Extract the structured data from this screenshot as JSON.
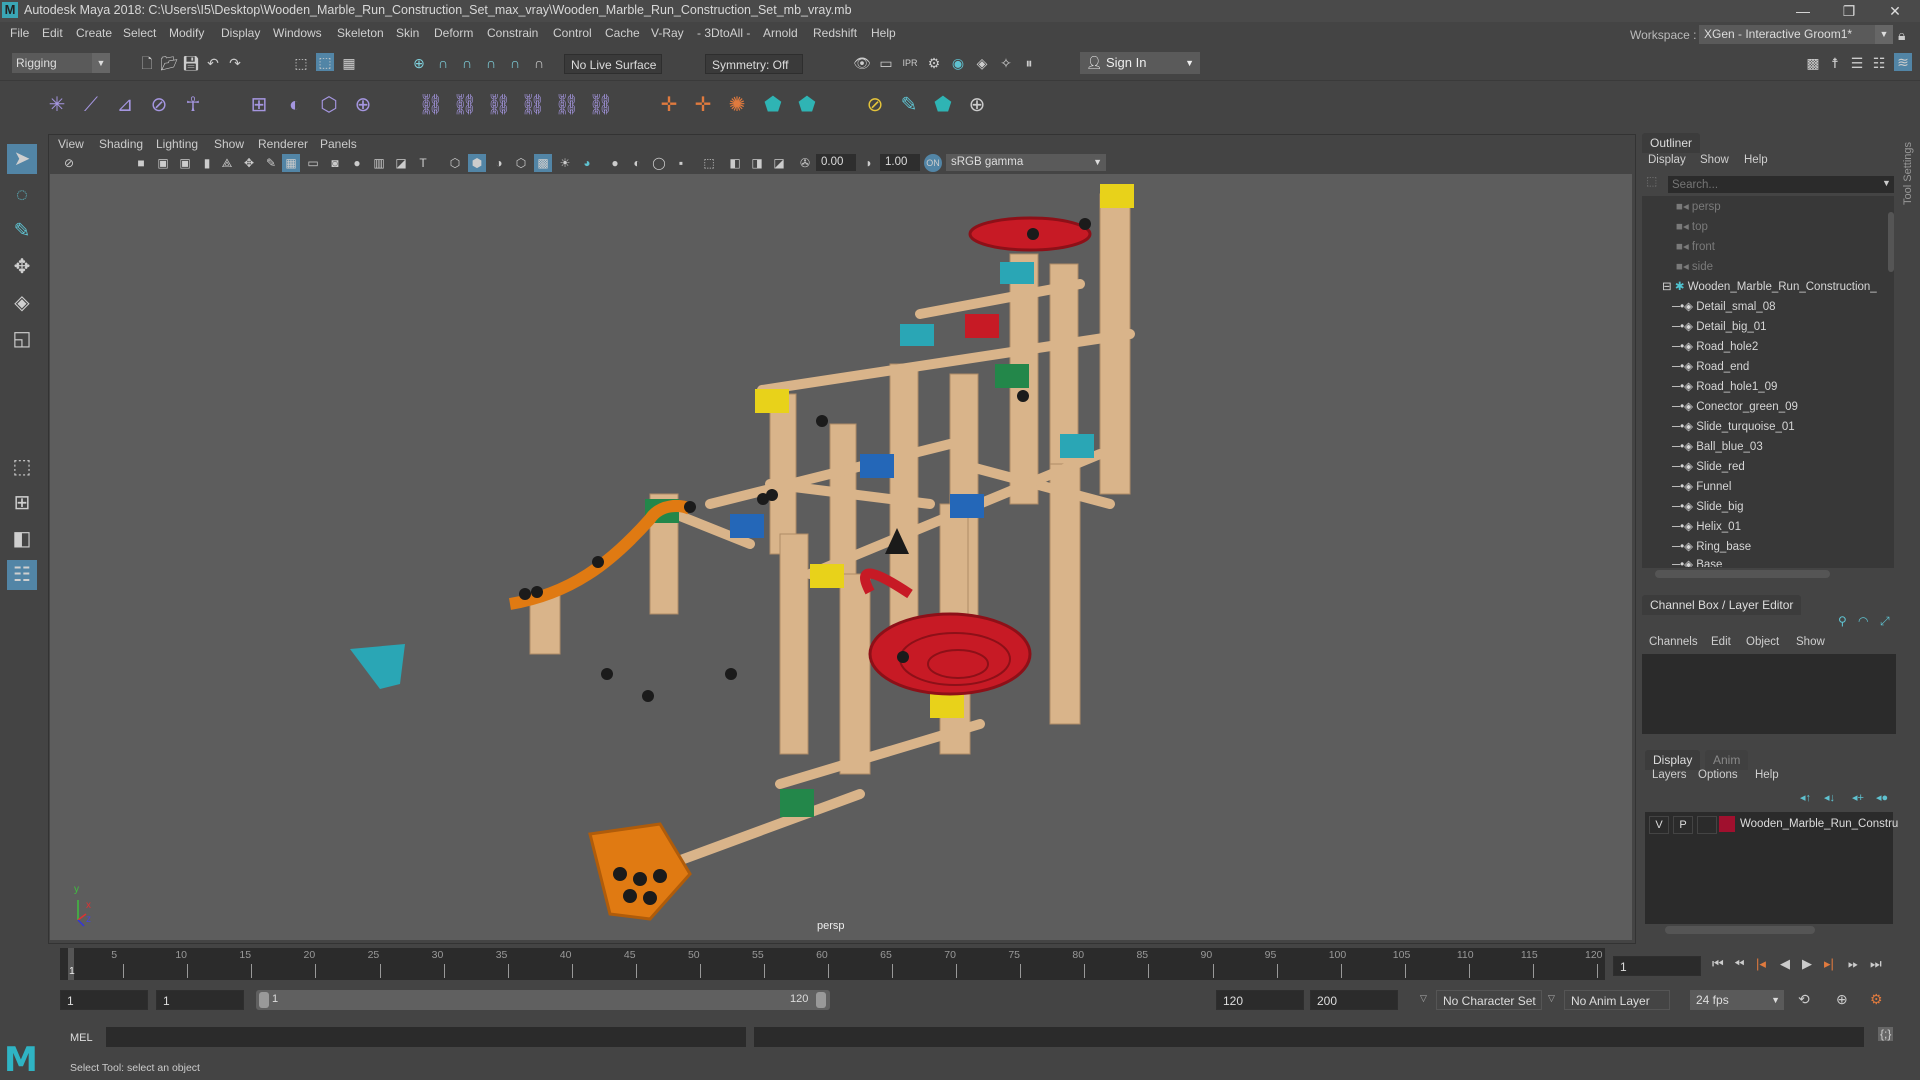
{
  "window": {
    "title": "Autodesk Maya 2018: C:\\Users\\I5\\Desktop\\Wooden_Marble_Run_Construction_Set_max_vray\\Wooden_Marble_Run_Construction_Set_mb_vray.mb",
    "minimize": "—",
    "restore": "❐",
    "close": "✕"
  },
  "menubar": {
    "items": [
      "File",
      "Edit",
      "Create",
      "Select",
      "Modify",
      "Display",
      "Windows",
      "Skeleton",
      "Skin",
      "Deform",
      "Constrain",
      "Control",
      "Cache",
      "V-Ray",
      "- 3DtoAll -",
      "Arnold",
      "Redshift",
      "Help"
    ],
    "workspace_label": "Workspace :",
    "workspace_value": "XGen - Interactive Groom1*"
  },
  "statusline": {
    "mode": "Rigging",
    "live_surface": "No Live Surface",
    "symmetry": "Symmetry: Off",
    "sign_in": "Sign In"
  },
  "viewport": {
    "menu": [
      "View",
      "Shading",
      "Lighting",
      "Show",
      "Renderer",
      "Panels"
    ],
    "exposure": "0.00",
    "gamma": "1.00",
    "color_space": "sRGB gamma",
    "camera_label": "persp",
    "axis": {
      "x": "x",
      "y": "y",
      "z": "z"
    }
  },
  "outliner": {
    "title": "Outliner",
    "menu": [
      "Display",
      "Show",
      "Help"
    ],
    "search_placeholder": "Search...",
    "cameras": [
      "persp",
      "top",
      "front",
      "side"
    ],
    "group": "Wooden_Marble_Run_Construction_",
    "children": [
      "Detail_smal_08",
      "Detail_big_01",
      "Road_hole2",
      "Road_end",
      "Road_hole1_09",
      "Conector_green_09",
      "Slide_turquoise_01",
      "Ball_blue_03",
      "Slide_red",
      "Funnel",
      "Slide_big",
      "Helix_01",
      "Ring_base",
      "Base"
    ]
  },
  "tool_settings_label": "Tool Settings",
  "channel_box": {
    "title": "Channel Box / Layer Editor",
    "menu": [
      "Channels",
      "Edit",
      "Object",
      "Show"
    ]
  },
  "layer_editor": {
    "tabs": [
      "Display",
      "Anim"
    ],
    "menu": [
      "Layers",
      "Options",
      "Help"
    ],
    "layers": [
      {
        "v": "V",
        "p": "P",
        "color": "#a0102e",
        "name": "Wooden_Marble_Run_Constru"
      }
    ]
  },
  "timeline": {
    "ticks": [
      5,
      10,
      15,
      20,
      25,
      30,
      35,
      40,
      45,
      50,
      55,
      60,
      65,
      70,
      75,
      80,
      85,
      90,
      95,
      100,
      105,
      110,
      115,
      120
    ],
    "current_frame_marker": "1",
    "current_frame": "1",
    "range_start": "1",
    "playback_start": "1",
    "slider_start": "1",
    "slider_end": "120",
    "playback_end": "120",
    "range_end": "200",
    "character_set": "No Character Set",
    "anim_layer": "No Anim Layer",
    "fps": "24 fps"
  },
  "command_line": {
    "label": "MEL"
  },
  "help_line": "Select Tool: select an object"
}
